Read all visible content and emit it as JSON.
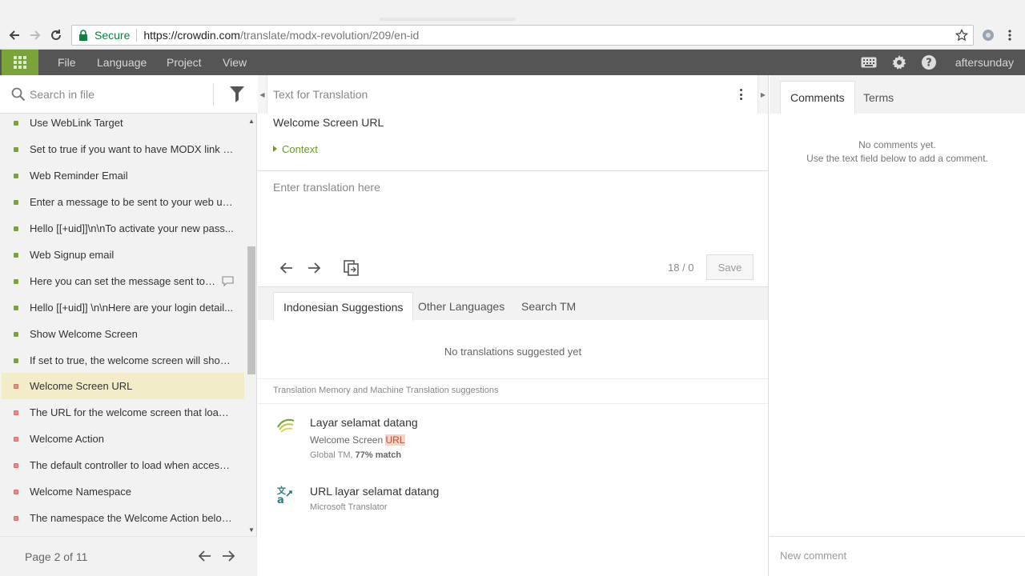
{
  "browser": {
    "secure_label": "Secure",
    "url_host": "https://crowdin.com",
    "url_path": "/translate/modx-revolution/209/en-id"
  },
  "menubar": {
    "items": [
      "File",
      "Language",
      "Project",
      "View"
    ],
    "username": "aftersunday"
  },
  "left_panel": {
    "search_placeholder": "Search in file",
    "strings": [
      {
        "text": "Use WebLink Target",
        "status": "translated"
      },
      {
        "text": "Set to true if you want to have MODX link t...",
        "status": "translated"
      },
      {
        "text": "Web Reminder Email",
        "status": "translated"
      },
      {
        "text": "Enter a message to be sent to your web us...",
        "status": "translated"
      },
      {
        "text": "Hello [[+uid]]\\n\\nTo activate your new pass...",
        "status": "translated"
      },
      {
        "text": "Web Signup email",
        "status": "translated"
      },
      {
        "text": "Here you can set the message sent to y...",
        "status": "translated",
        "has_comment": true
      },
      {
        "text": "Hello [[+uid]] \\n\\nHere are your login detail...",
        "status": "translated"
      },
      {
        "text": "Show Welcome Screen",
        "status": "translated"
      },
      {
        "text": "If set to true, the welcome screen will show ...",
        "status": "translated"
      },
      {
        "text": "Welcome Screen URL",
        "status": "untranslated",
        "active": true
      },
      {
        "text": "The URL for the welcome screen that loads ...",
        "status": "untranslated"
      },
      {
        "text": "Welcome Action",
        "status": "untranslated"
      },
      {
        "text": "The default controller to load when accessi...",
        "status": "untranslated"
      },
      {
        "text": "Welcome Namespace",
        "status": "untranslated"
      },
      {
        "text": "The namespace the Welcome Action belon...",
        "status": "untranslated"
      }
    ],
    "pager_text": "Page 2 of 11"
  },
  "editor": {
    "section_label": "Text for Translation",
    "source_text": "Welcome Screen URL",
    "context_label": "Context",
    "translation_placeholder": "Enter translation here",
    "counter": "18 / 0",
    "save_label": "Save"
  },
  "suggestions": {
    "tabs": [
      "Indonesian Suggestions",
      "Other Languages",
      "Search TM"
    ],
    "empty_text": "No translations suggested yet",
    "tm_header": "Translation Memory and Machine Translation suggestions",
    "items": [
      {
        "translation": "Layar selamat datang",
        "source_prefix": "Welcome Screen ",
        "source_highlight": "URL",
        "meta_prefix": "Global TM, ",
        "meta_bold": "77% match",
        "icon": "global-tm-icon"
      },
      {
        "translation": "URL layar selamat datang",
        "meta_prefix": "Microsoft Translator",
        "icon": "machine-translation-icon"
      }
    ]
  },
  "right_panel": {
    "tabs": [
      "Comments",
      "Terms"
    ],
    "no_comments_line1": "No comments yet.",
    "no_comments_line2": "Use the text field below to add a comment.",
    "new_comment_placeholder": "New comment"
  },
  "colors": {
    "accent_green": "#7aa33a",
    "untranslated_red": "#e88b8b",
    "menubar": "#555555",
    "active_row": "#f3ecc8"
  }
}
